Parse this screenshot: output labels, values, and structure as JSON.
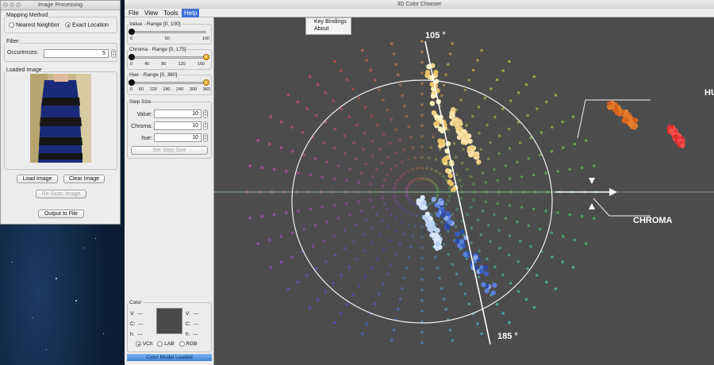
{
  "image_window": {
    "title": "Image Processing",
    "mapping_group": "Mapping Method",
    "mapping_options": [
      "Nearest Neighbor",
      "Exact Location"
    ],
    "filter_group": "Filter",
    "occurrences_label": "Occurences:",
    "occurrences_value": "5",
    "loaded_image_group": "Loaded Image",
    "load_button": "Load Image",
    "clear_button": "Clear Image",
    "rescan_button": "Re-Scan Image",
    "output_button": "Output to File"
  },
  "chooser_window": {
    "title": "3D Color Chooser",
    "menus": [
      "File",
      "View",
      "Tools",
      "Help"
    ],
    "help_menu_items": [
      "Key Bindings",
      "About"
    ],
    "value_slider": {
      "label": "Value - Range [0, 100]",
      "ticks": [
        "0",
        "50",
        "100"
      ]
    },
    "chroma_slider": {
      "label": "Chroma - Range [0, 175]",
      "ticks": [
        "0",
        "40",
        "80",
        "120",
        "160"
      ]
    },
    "hue_slider": {
      "label": "Hue - Range [0, 360]",
      "ticks": [
        "0",
        "60",
        "120",
        "180",
        "240",
        "300",
        "360"
      ]
    },
    "step_size_group": "Step Size",
    "steps": [
      {
        "label": "Value:",
        "value": "10"
      },
      {
        "label": "Chroma:",
        "value": "10"
      },
      {
        "label": "hue:",
        "value": "10"
      }
    ],
    "set_step_button": "Set Step Size",
    "color_group": "Color",
    "color_left": [
      {
        "label": "V:",
        "value": "---"
      },
      {
        "label": "C:",
        "value": "---"
      },
      {
        "label": "h:",
        "value": "---"
      }
    ],
    "color_right": [
      {
        "label": "V:",
        "value": "---"
      },
      {
        "label": "C:",
        "value": "---"
      },
      {
        "label": "h:",
        "value": "---"
      }
    ],
    "color_models": [
      "VCh",
      "LAB",
      "RGB"
    ],
    "status": "Color Model Loaded"
  },
  "plot_annotations": {
    "angle_top": "105 °",
    "angle_bottom": "185 °",
    "hue_label": "HUE",
    "chroma_label": "CHROMA"
  }
}
